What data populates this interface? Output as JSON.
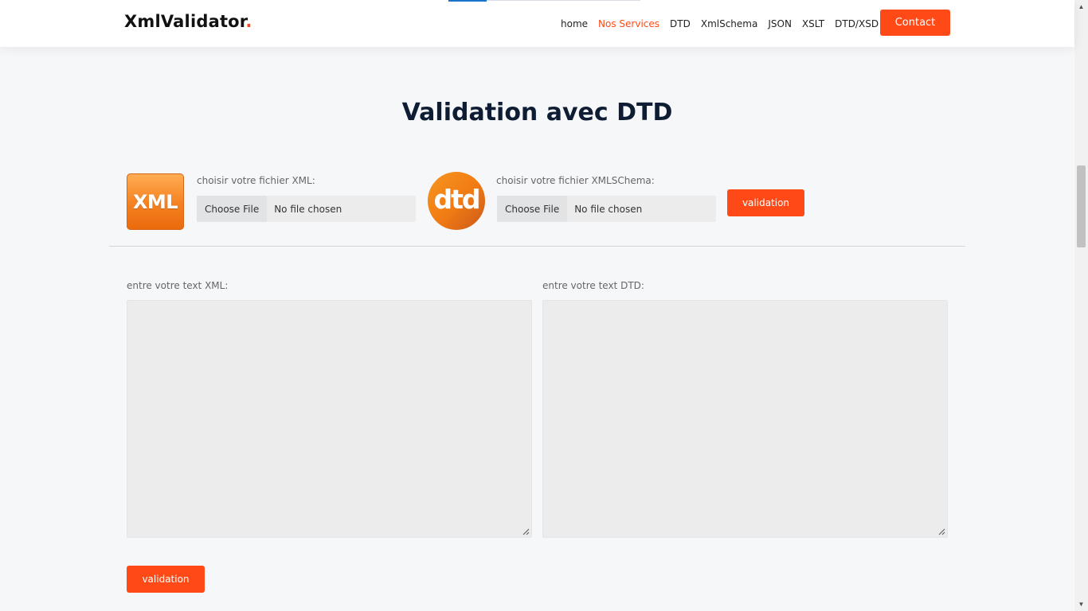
{
  "header": {
    "logo_text": "XmlValidator",
    "logo_dot": ".",
    "nav": [
      {
        "label": "home",
        "active": false
      },
      {
        "label": "Nos Services",
        "active": true
      },
      {
        "label": "DTD",
        "active": false
      },
      {
        "label": "XmlSchema",
        "active": false
      },
      {
        "label": "JSON",
        "active": false
      },
      {
        "label": "XSLT",
        "active": false
      },
      {
        "label": "DTD/XSD",
        "active": false
      }
    ],
    "contact_label": "Contact"
  },
  "main": {
    "title": "Validation avec DTD",
    "xml_logo_text": "XML",
    "dtd_logo_text": "dtd",
    "xml_file": {
      "label": "choisir votre fichier XML:",
      "button": "Choose File",
      "status": "No file chosen"
    },
    "schema_file": {
      "label": "choisir votre fichier XMLSChema:",
      "button": "Choose File",
      "status": "No file chosen"
    },
    "validate_files_label": "validation",
    "xml_text_label": "entre votre text XML:",
    "dtd_text_label": "entre votre text DTD:",
    "xml_text_value": "",
    "dtd_text_value": "",
    "validate_text_label": "validation"
  },
  "colors": {
    "accent": "#ff4a17",
    "title": "#0e1d34",
    "background": "#f6f7f9",
    "header_bg": "#ffffff"
  },
  "icons": {
    "scroll_up": "scroll-up-arrow-icon",
    "scroll_down": "scroll-down-arrow-icon",
    "resize": "resize-grip-icon"
  }
}
